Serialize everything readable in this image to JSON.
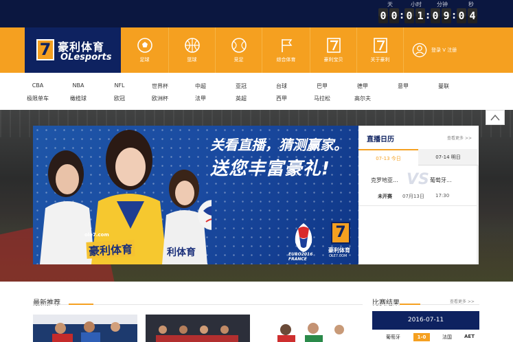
{
  "countdown": {
    "labels": [
      "天",
      "小时",
      "分钟",
      "秒"
    ],
    "digits": [
      "0",
      "0",
      "0",
      "1",
      "0",
      "9",
      "0",
      "4"
    ]
  },
  "brand": {
    "name_cn": "豪利体育",
    "name_en": "OLesports",
    "glyph": "7"
  },
  "nav": {
    "items": [
      {
        "label": "足球",
        "icon": "soccer-ball-icon"
      },
      {
        "label": "篮球",
        "icon": "basketball-icon"
      },
      {
        "label": "竞足",
        "icon": "tennis-ball-icon"
      },
      {
        "label": "综合体育",
        "icon": "flag-icon"
      },
      {
        "label": "豪利宝贝",
        "icon": "seven-logo-icon"
      },
      {
        "label": "关于豪利",
        "icon": "seven-logo-icon"
      }
    ],
    "login_label": "登录 V 注册"
  },
  "leagues": {
    "row1": [
      "CBA",
      "NBA",
      "NFL",
      "世界杯",
      "中超",
      "亚冠",
      "台球",
      "巴甲",
      "德甲",
      "意甲",
      "曼联"
    ],
    "row2": [
      "极限单车",
      "橄榄球",
      "欧冠",
      "欧洲杯",
      "法甲",
      "英超",
      "西甲",
      "马拉松",
      "高尔夫"
    ]
  },
  "banner": {
    "headline1": "关看直播，猜测赢家。",
    "headline2": "送您丰富豪礼!",
    "url": "ole7.com",
    "brand_cn": "豪利体育",
    "brand_cn2": "利体育",
    "euro_text": "EURO2016",
    "euro_sub": "FRANCE",
    "seven_cn": "豪利体育",
    "seven_url": "OLE7.COM"
  },
  "schedule": {
    "title": "直播日历",
    "more": "查看更多 >>",
    "tab_active": "07-13 今日",
    "tab_other": "07-14 明日",
    "team_a": "克罗地亚...",
    "vs": "VS",
    "team_b": "葡萄牙...",
    "status": "未开赛",
    "date": "07月13日",
    "time": "17:30"
  },
  "latest": {
    "title": "最新推荐"
  },
  "results": {
    "title": "比赛结果",
    "more": "查看更多 >>",
    "date": "2016-07-11",
    "home": "葡萄牙",
    "score": "1-0",
    "away": "法国",
    "note": "AET"
  },
  "colors": {
    "navy": "#0e2260",
    "orange": "#f5a020",
    "topbar": "#0b1740"
  }
}
